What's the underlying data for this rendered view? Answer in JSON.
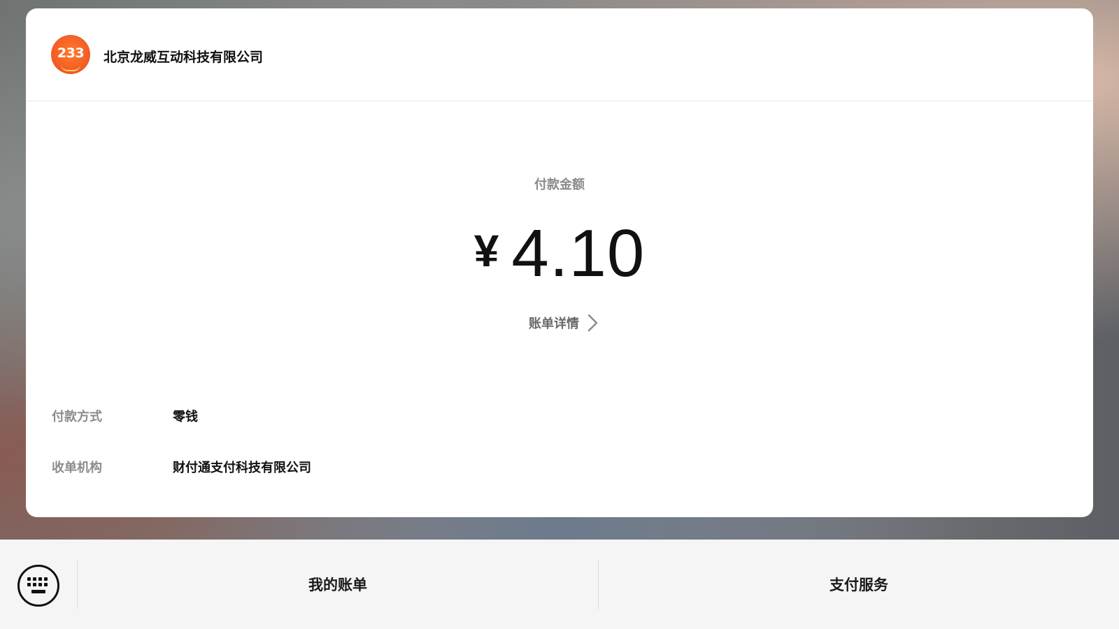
{
  "merchant": {
    "logo_text": "233",
    "name": "北京龙威互动科技有限公司"
  },
  "payment": {
    "amount_label": "付款金额",
    "currency_symbol": "¥",
    "amount": "4.10",
    "bill_detail_label": "账单详情"
  },
  "details": [
    {
      "label": "付款方式",
      "value": "零钱"
    },
    {
      "label": "收单机构",
      "value": "财付通支付科技有限公司"
    }
  ],
  "bottom_menu": {
    "items": [
      {
        "label": "我的账单"
      },
      {
        "label": "支付服务"
      }
    ]
  },
  "colors": {
    "logo_orange": "#f15a24",
    "muted_text": "#8a8a8a",
    "primary_text": "#111111",
    "menu_bg": "#f5f5f5"
  }
}
